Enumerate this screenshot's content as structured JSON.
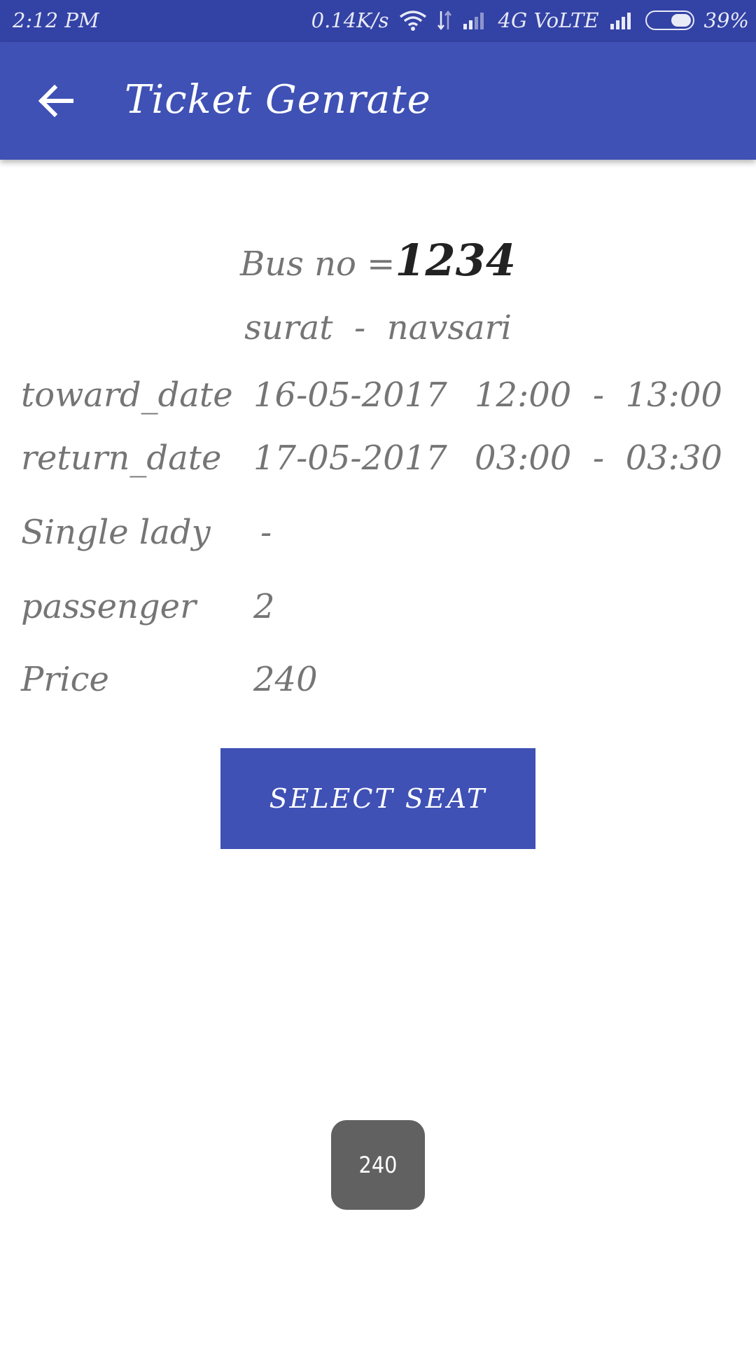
{
  "status_bar": {
    "time": "2:12 PM",
    "net_speed": "0.14K/s",
    "network": "4G VoLTE",
    "battery": "39%",
    "battery_level": 0.39
  },
  "app_bar": {
    "title": "Ticket Genrate",
    "back_icon": "arrow-back-icon"
  },
  "ticket": {
    "bus_label": "Bus no =",
    "bus_no": "1234",
    "route": "surat  -  navsari",
    "toward": {
      "label": "toward_date",
      "date": "16-05-2017",
      "time": "12:00  -  13:00"
    },
    "return": {
      "label": "return_date",
      "date": "17-05-2017",
      "time": "03:00  -  03:30"
    },
    "single_lady": {
      "label": "Single lady",
      "value": "-"
    },
    "passenger": {
      "label": "passenger",
      "value": "2"
    },
    "price": {
      "label": "Price",
      "value": "240"
    }
  },
  "actions": {
    "select_seat": "SELECT SEAT"
  },
  "toast": {
    "text": "240"
  },
  "colors": {
    "primary": "#3f51b5",
    "primary_dark": "#3342a5",
    "text_secondary": "#757575",
    "toast_bg": "#616161"
  }
}
